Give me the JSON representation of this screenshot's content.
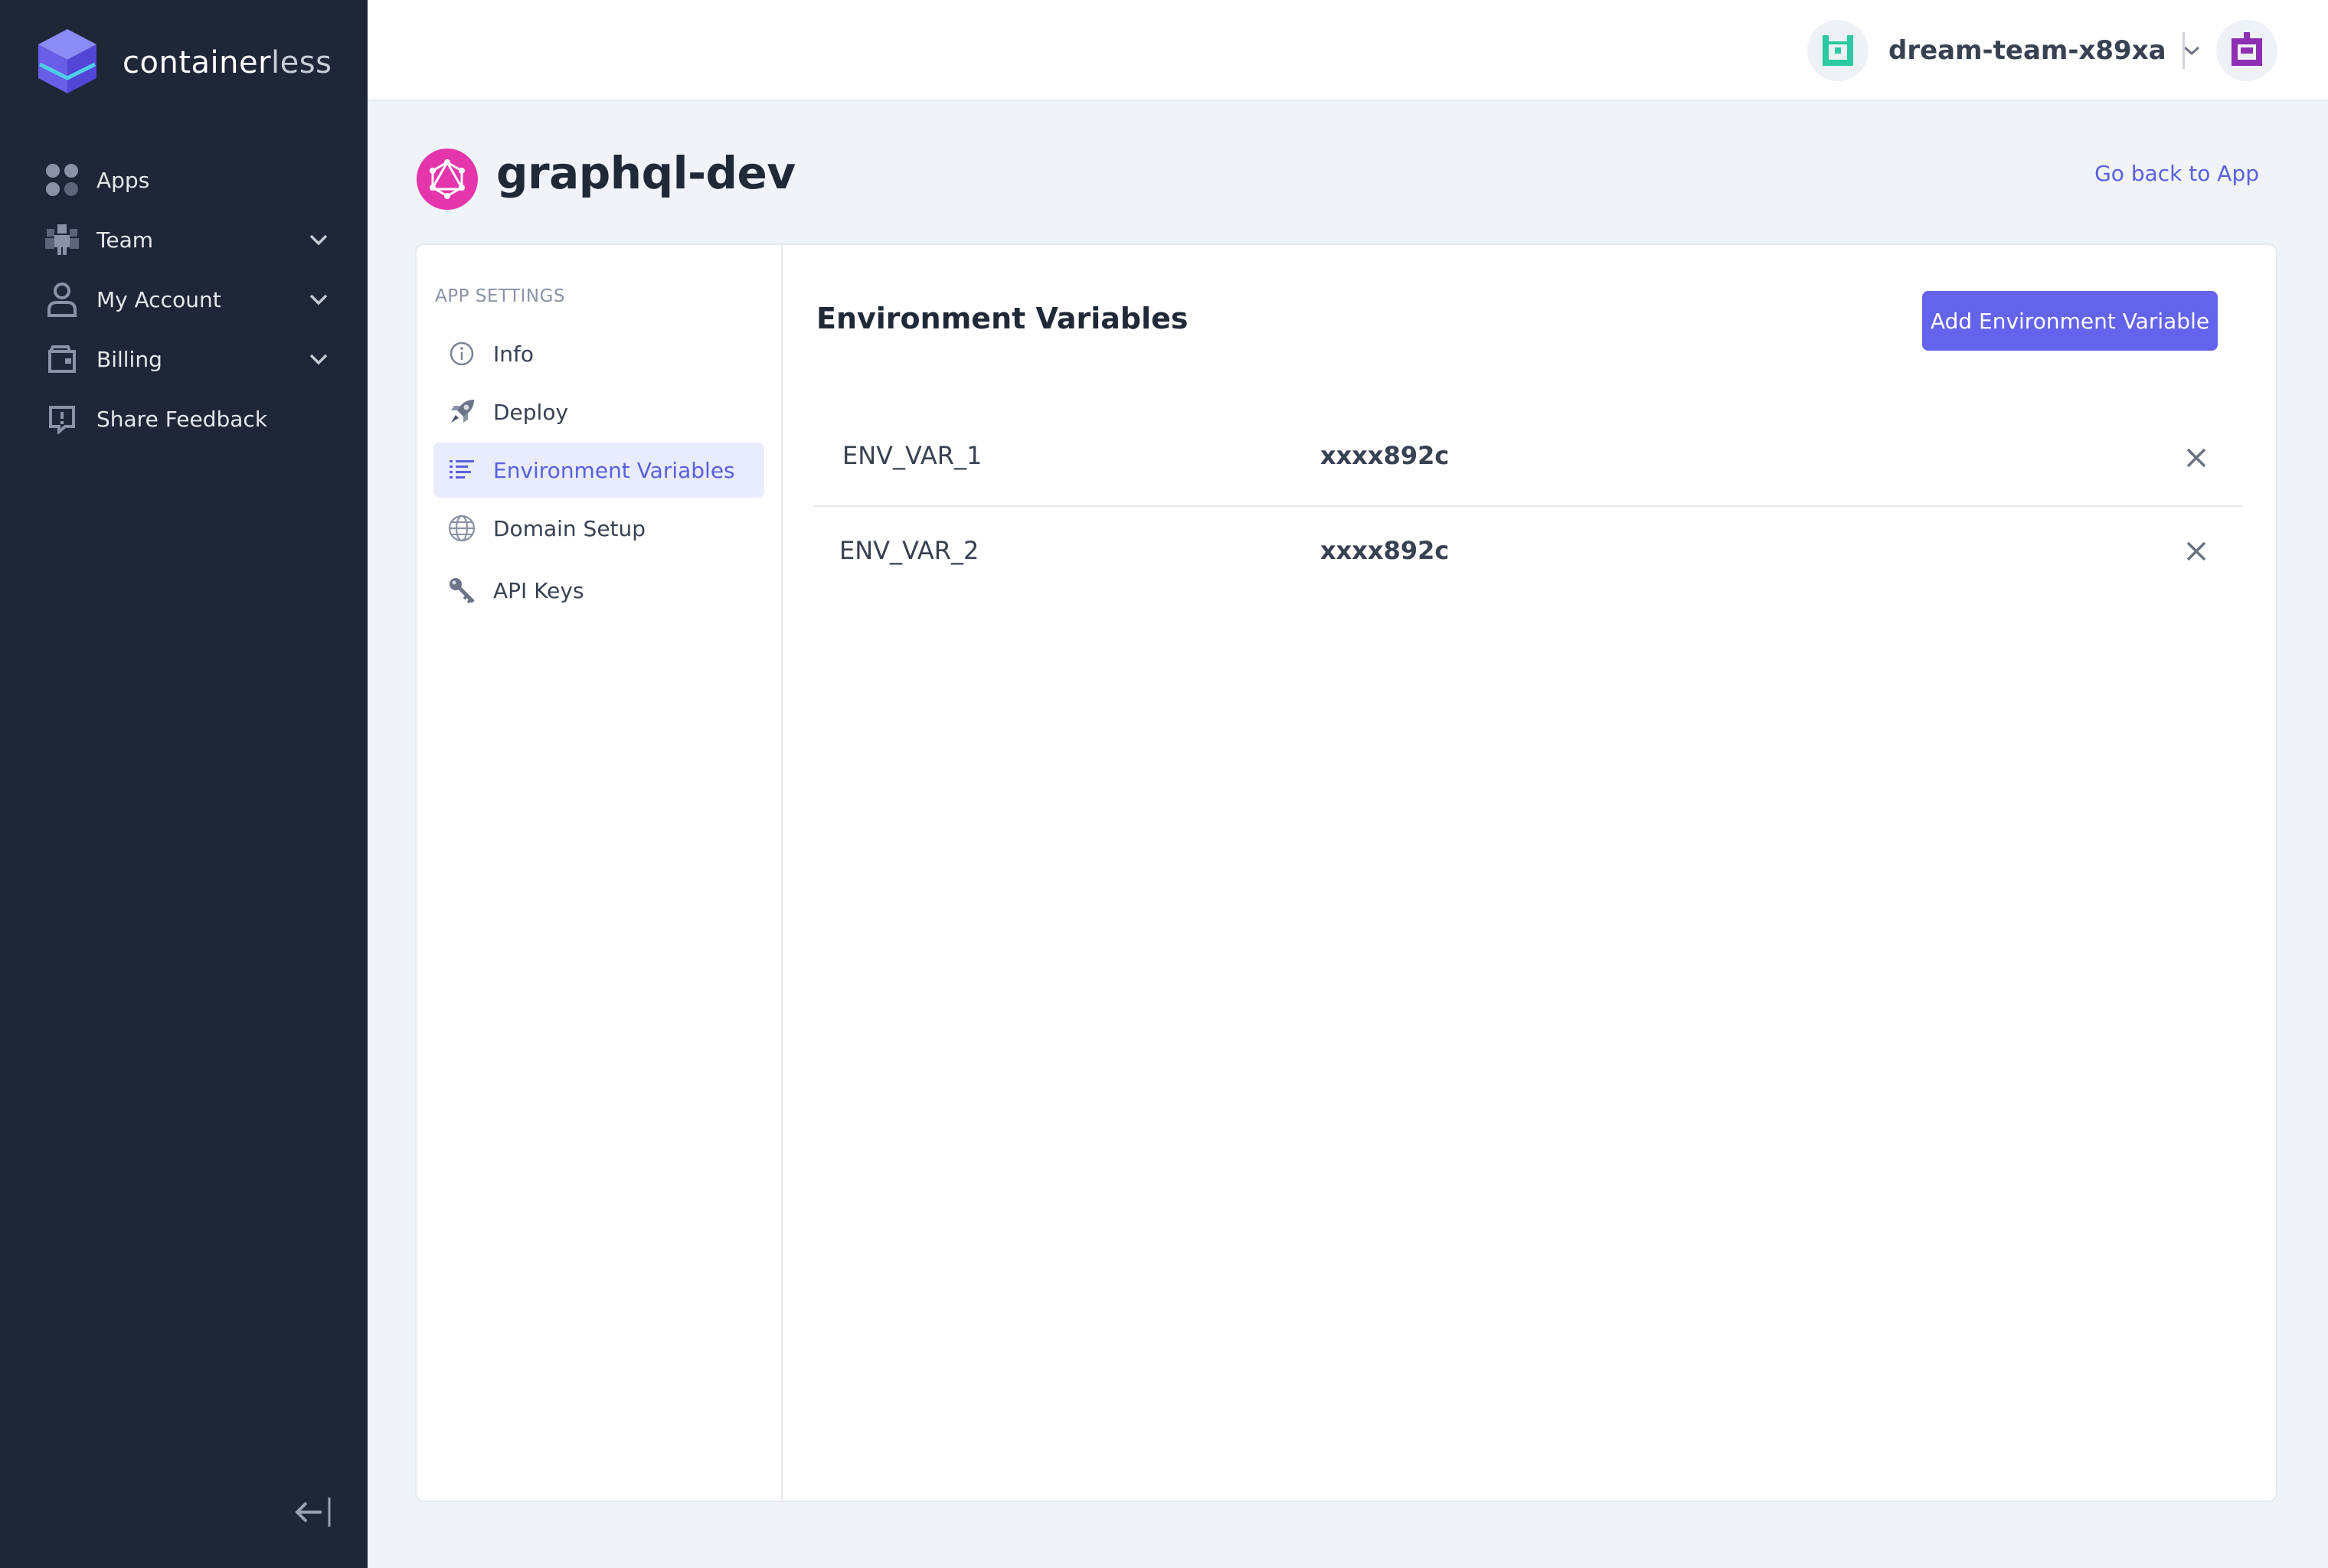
{
  "brand": {
    "name_main": "container",
    "name_light": "less"
  },
  "sidebar": {
    "items": [
      {
        "label": "Apps",
        "icon": "apps-grid-icon",
        "has_chevron": false
      },
      {
        "label": "Team",
        "icon": "team-icon",
        "has_chevron": true
      },
      {
        "label": "My Account",
        "icon": "user-icon",
        "has_chevron": true
      },
      {
        "label": "Billing",
        "icon": "wallet-icon",
        "has_chevron": true
      },
      {
        "label": "Share Feedback",
        "icon": "feedback-icon",
        "has_chevron": false
      }
    ],
    "collapse_icon": "collapse-left-icon"
  },
  "topbar": {
    "team_name": "dream-team-x89xa",
    "team_avatar_color": "#2bc9a0",
    "user_avatar_color": "#8e2fb3"
  },
  "page": {
    "app_name": "graphql-dev",
    "app_icon_color": "#e535ab",
    "back_link": "Go back to App"
  },
  "settings": {
    "heading": "APP SETTINGS",
    "items": [
      {
        "label": "Info",
        "icon": "info-icon",
        "active": false
      },
      {
        "label": "Deploy",
        "icon": "rocket-icon",
        "active": false
      },
      {
        "label": "Environment Variables",
        "icon": "list-icon",
        "active": true
      },
      {
        "label": "Domain Setup",
        "icon": "globe-icon",
        "active": false
      },
      {
        "label": "API Keys",
        "icon": "key-icon",
        "active": false
      }
    ]
  },
  "env": {
    "title": "Environment Variables",
    "add_button": "Add Environment Variable",
    "accent_color": "#6363ec",
    "rows": [
      {
        "key": "ENV_VAR_1",
        "value": "xxxx892c"
      },
      {
        "key": "ENV_VAR_2",
        "value": "xxxx892c"
      }
    ]
  }
}
